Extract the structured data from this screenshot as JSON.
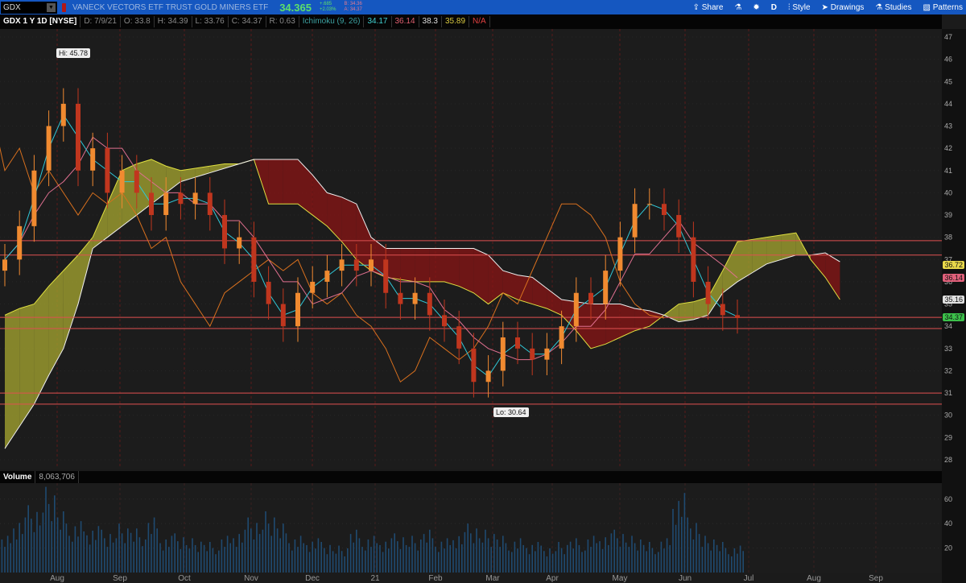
{
  "header": {
    "symbol": "GDX",
    "description": "VANECK VECTORS ETF TRUST GOLD MINERS ETF",
    "last": "34.365",
    "change": "+.685",
    "change_pct": "+2.03%",
    "bid": "B: 34.36",
    "ask": "A: 34.37"
  },
  "toolbar": {
    "share": "Share",
    "period": "D",
    "style": "Style",
    "drawings": "Drawings",
    "studies": "Studies",
    "patterns": "Patterns"
  },
  "infobar": {
    "title": "GDX 1 Y 1D [NYSE]",
    "date": "D: 7/9/21",
    "open": "O: 33.8",
    "high": "H: 34.39",
    "low": "L: 33.76",
    "close": "C: 34.37",
    "range": "R: 0.63",
    "study": "Ichimoku (9, 26)",
    "v1": "34.17",
    "v2": "36.14",
    "v3": "38.3",
    "v4": "35.89",
    "v5": "N/A"
  },
  "annotations": {
    "hi": "Hi: 45.78",
    "lo": "Lo: 30.64"
  },
  "price_labels": [
    {
      "text": "36.72",
      "color": "#e8d84a",
      "price": 36.72
    },
    {
      "text": "36.14",
      "color": "#e0607a",
      "price": 36.14
    },
    {
      "text": "35.16",
      "color": "#e0e0e0",
      "price": 35.16
    },
    {
      "text": "34.37",
      "color": "#3cc04a",
      "price": 34.37
    }
  ],
  "volume": {
    "label": "Volume",
    "value": "8,063,706"
  },
  "colors": {
    "up": "#f08a30",
    "down": "#c0361e",
    "cloud_up": "#a8a830",
    "cloud_down": "#8a1414",
    "tenkan": "#30c8d8",
    "kijun": "#e07090",
    "lagging": "#d8701e",
    "hline": "#e05050"
  },
  "chart_data": {
    "type": "candlestick",
    "price_axis": {
      "min": 28,
      "max": 47,
      "ticks": [
        28,
        29,
        30,
        31,
        32,
        33,
        34,
        35,
        36,
        37,
        38,
        39,
        40,
        41,
        42,
        43,
        44,
        45,
        46,
        47
      ]
    },
    "month_labels": [
      "Aug",
      "Sep",
      "Oct",
      "Nov",
      "Dec",
      "21",
      "Feb",
      "Mar",
      "Apr",
      "May",
      "Jun",
      "Jul",
      "Aug",
      "Sep"
    ],
    "weekly_close": [
      37,
      38.5,
      41,
      43,
      44,
      41,
      42,
      40,
      41,
      40,
      39,
      40,
      39.5,
      40,
      39,
      37.5,
      38,
      36,
      35,
      34,
      35.5,
      36,
      36.5,
      37,
      36.5,
      37,
      35.5,
      35,
      35.5,
      34.5,
      34,
      33,
      31.5,
      32,
      33.5,
      33,
      32.5,
      33,
      34,
      35.5,
      35,
      36.5,
      38,
      39.5,
      39.5,
      39,
      38,
      36,
      35,
      34.5,
      34.37
    ],
    "cloud_span_a": [
      34.5,
      34.8,
      35,
      35.8,
      36.5,
      37.2,
      38,
      39.5,
      41,
      41.3,
      41.5,
      41.2,
      41,
      41.1,
      41.2,
      41.3,
      41.3,
      41.5,
      39.5,
      39.5,
      39.5,
      39,
      38.5,
      37.8,
      37,
      36.5,
      36.2,
      36.1,
      36,
      36,
      36,
      35.8,
      35.5,
      35,
      35.5,
      35.2,
      35,
      34.8,
      34.5,
      33.8,
      33,
      33.2,
      33.5,
      33.8,
      34,
      34.5,
      35,
      35.1,
      35.3,
      36.5,
      37.8,
      37.9,
      38,
      38.1,
      38.2,
      37,
      36.2,
      35.2
    ],
    "cloud_span_b": [
      28.5,
      29.5,
      30.5,
      31.8,
      33,
      35,
      37.5,
      38,
      38.5,
      39,
      39.5,
      40,
      40.5,
      40.7,
      40.9,
      41.1,
      41.3,
      41.5,
      41.5,
      41.5,
      41.5,
      40.8,
      40,
      39.8,
      39.5,
      38,
      37.5,
      37.5,
      37.5,
      37.5,
      37.5,
      37.5,
      37.5,
      37.2,
      36.5,
      36.3,
      36.2,
      35.7,
      35.2,
      35.1,
      35,
      35,
      35,
      34.8,
      34.7,
      34.5,
      34.2,
      34.3,
      34.5,
      35.5,
      36,
      36.4,
      36.8,
      37,
      37.2,
      37.2,
      37.3,
      36.9
    ],
    "horizontal_levels": [
      37.85,
      37.2,
      34.4,
      33.9,
      31.0,
      30.5
    ],
    "volume_axis": {
      "min": 0,
      "max": 70,
      "ticks": [
        20,
        40,
        60
      ]
    },
    "weekly_volume_millions": [
      30,
      45,
      55,
      70,
      50,
      42,
      38,
      35,
      40,
      36,
      45,
      30,
      32,
      28,
      25,
      30,
      35,
      45,
      50,
      40,
      30,
      28,
      25,
      22,
      35,
      30,
      28,
      32,
      30,
      35,
      28,
      33,
      40,
      35,
      30,
      28,
      25,
      22,
      25,
      28,
      30,
      32,
      35,
      30,
      25,
      28,
      65,
      45,
      30,
      25,
      22
    ]
  }
}
